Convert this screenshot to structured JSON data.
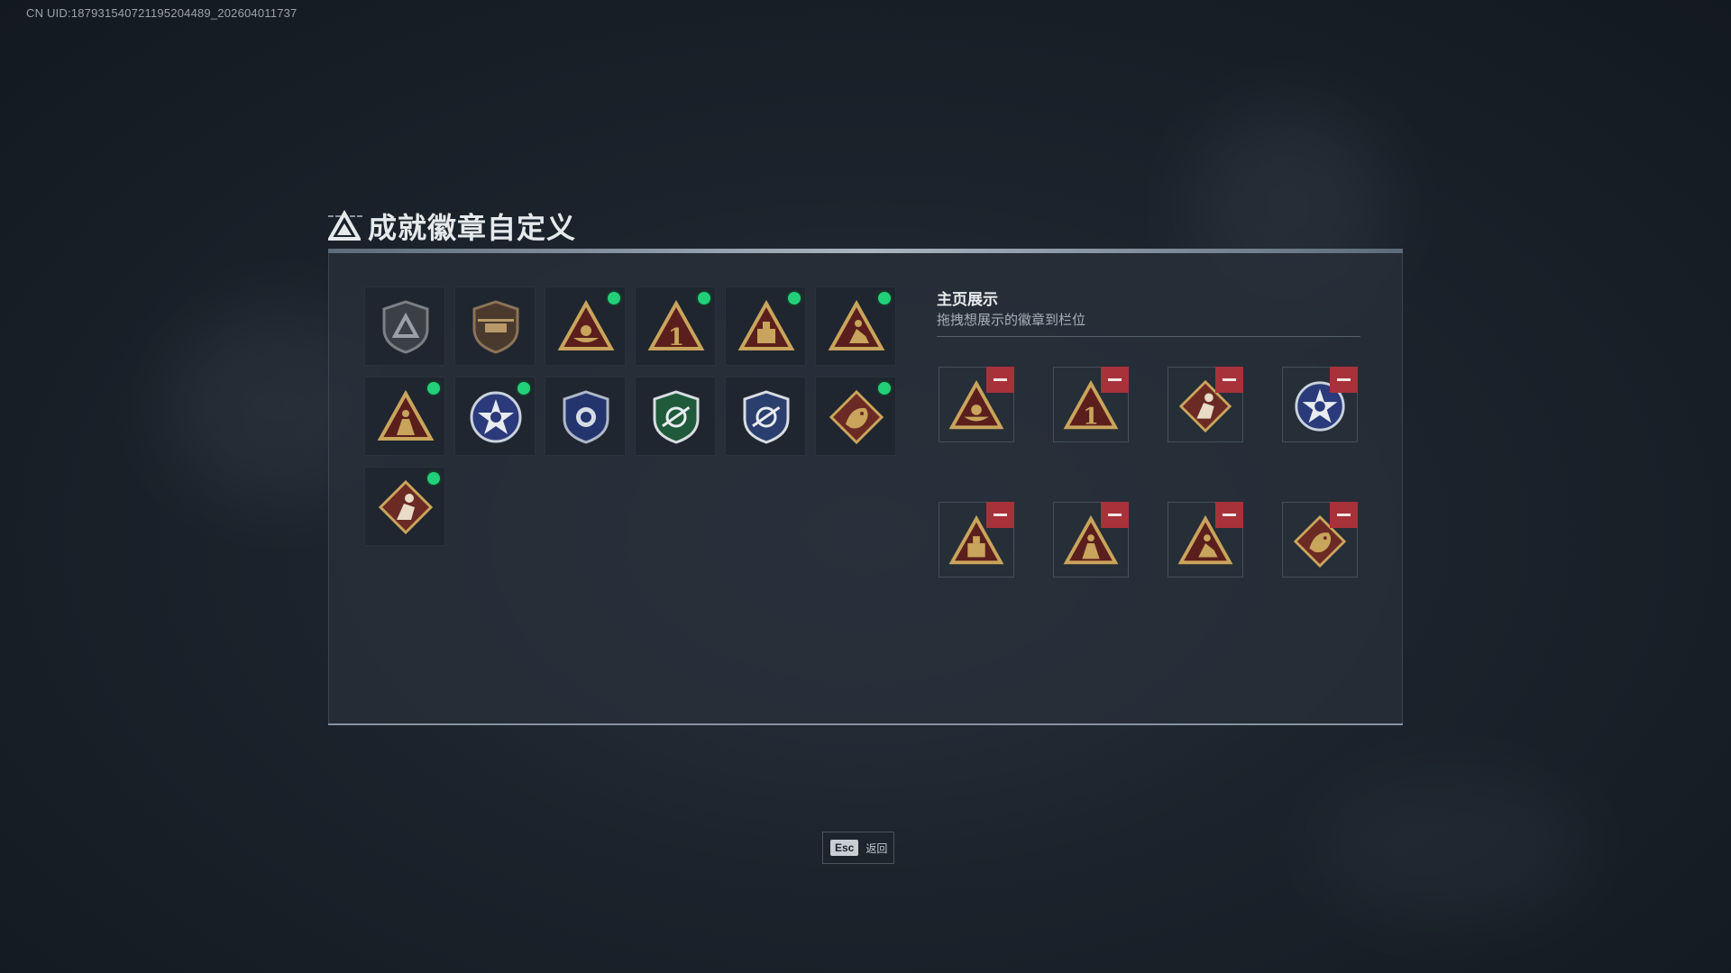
{
  "header": {
    "uid": "CN UID:1879315407211952044​89_202604011737"
  },
  "window": {
    "title": "成就徽章自定义"
  },
  "badges": [
    {
      "icon": "shield-triangle-badge-icon",
      "new": false
    },
    {
      "icon": "helicopter-shield-badge-icon",
      "new": false
    },
    {
      "icon": "triangle-bowl-badge-icon",
      "new": true
    },
    {
      "icon": "triangle-number-one-badge-icon",
      "new": true
    },
    {
      "icon": "triangle-crate-badge-icon",
      "new": true
    },
    {
      "icon": "triangle-runner-badge-icon",
      "new": true
    },
    {
      "icon": "triangle-soldier-badge-icon",
      "new": true
    },
    {
      "icon": "star-eagle-badge-icon",
      "new": true
    },
    {
      "icon": "blue-police-badge-icon",
      "new": false
    },
    {
      "icon": "green-rifle-shield-badge-icon",
      "new": false
    },
    {
      "icon": "blue-rifle-shield-badge-icon",
      "new": false
    },
    {
      "icon": "dragon-diamond-badge-icon",
      "new": true
    },
    {
      "icon": "diamond-warrior-badge-icon",
      "new": true
    }
  ],
  "showcase": {
    "title": "主页展示",
    "subtitle": "拖拽想展示的徽章到栏位",
    "slots": [
      {
        "icon": "triangle-bowl-badge-icon"
      },
      {
        "icon": "triangle-number-one-badge-icon"
      },
      {
        "icon": "diamond-warrior-badge-icon"
      },
      {
        "icon": "star-eagle-badge-icon"
      },
      {
        "icon": "triangle-crate-badge-icon"
      },
      {
        "icon": "triangle-soldier-badge-icon"
      },
      {
        "icon": "triangle-runner-badge-icon"
      },
      {
        "icon": "dragon-diamond-badge-icon"
      }
    ]
  },
  "footer": {
    "esc_key": "Esc",
    "esc_label": "返回"
  },
  "colors": {
    "gold": "#c9a45c",
    "red": "#a8323a",
    "green_dot": "#22d07a"
  }
}
